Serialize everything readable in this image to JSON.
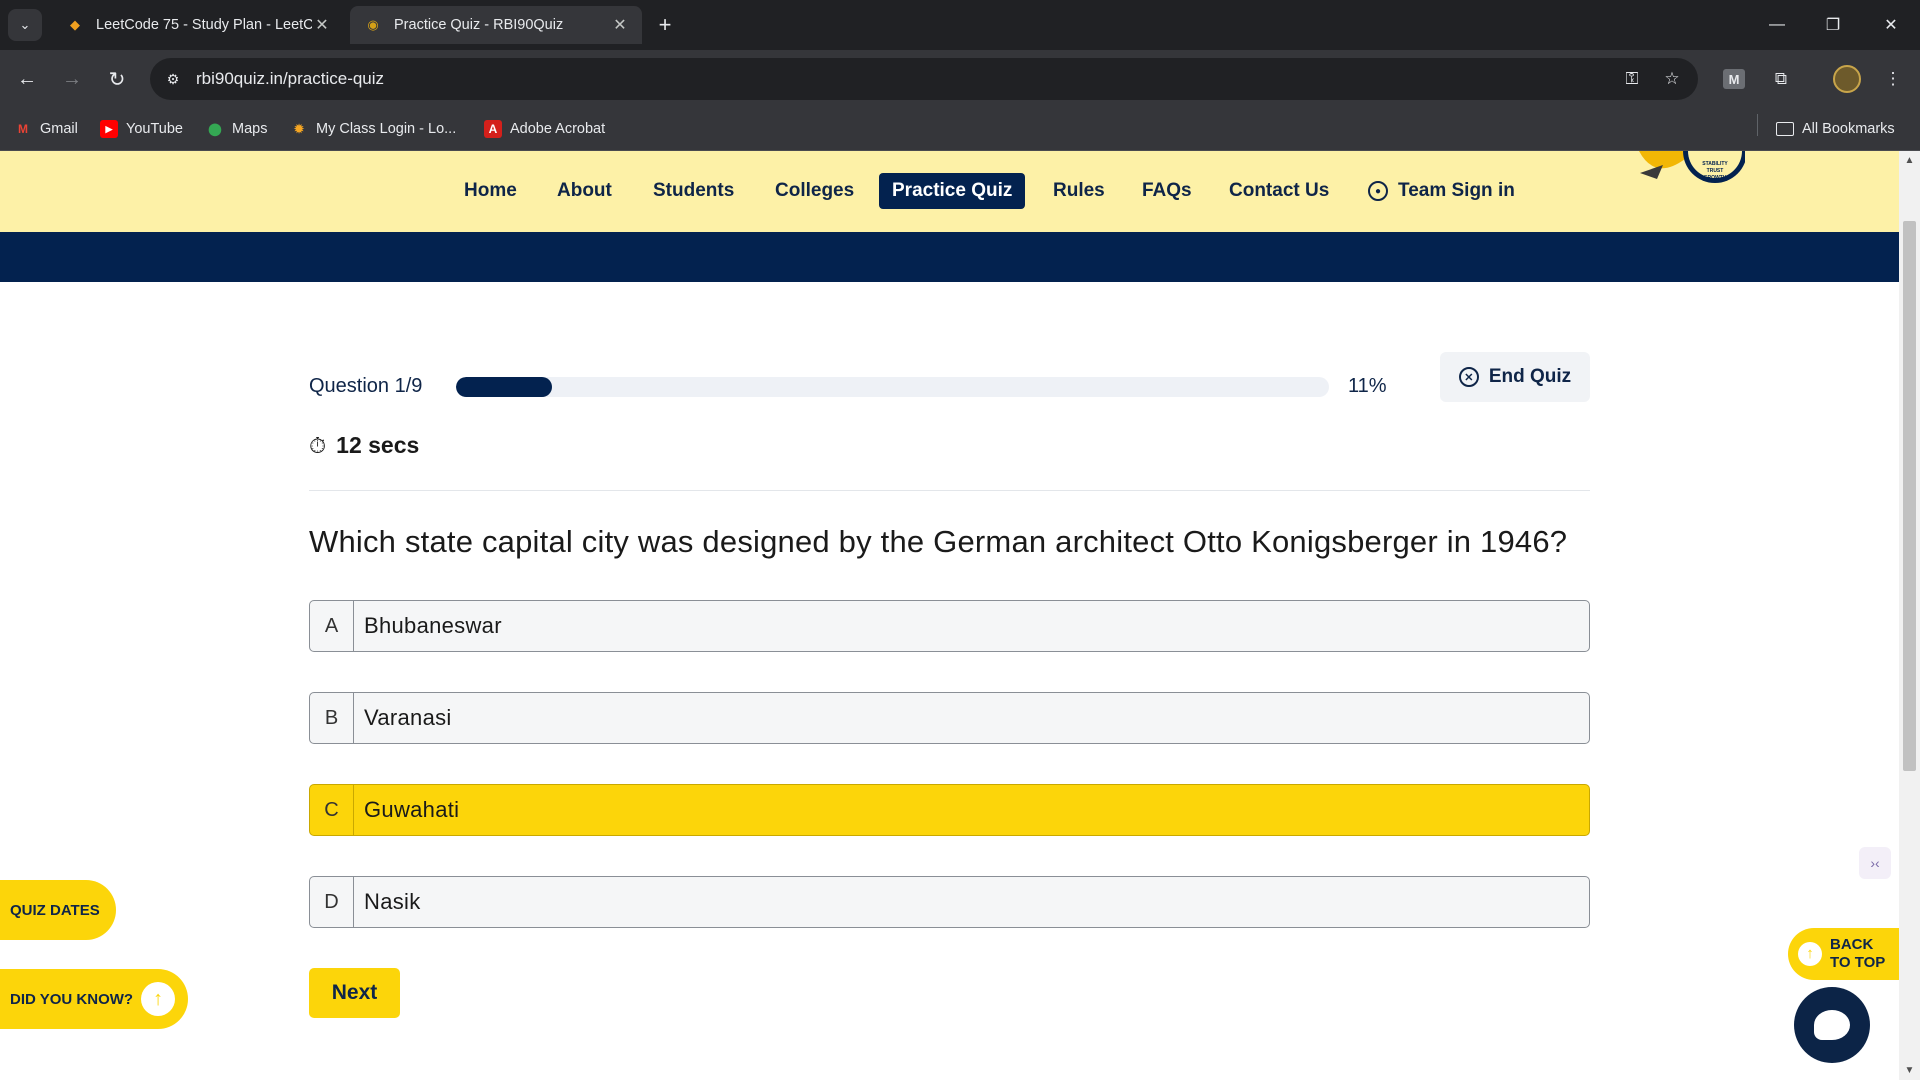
{
  "browser": {
    "tabs": [
      {
        "title": "LeetCode 75 - Study Plan - LeetCode",
        "active": false
      },
      {
        "title": "Practice Quiz - RBI90Quiz",
        "active": true
      }
    ],
    "url": "rbi90quiz.in/practice-quiz",
    "bookmarks": [
      {
        "label": "Gmail",
        "icon": "gmail-icon"
      },
      {
        "label": "YouTube",
        "icon": "youtube-icon"
      },
      {
        "label": "Maps",
        "icon": "maps-icon"
      },
      {
        "label": "My Class Login - Lo...",
        "icon": "sun-icon"
      },
      {
        "label": "Adobe Acrobat",
        "icon": "acrobat-icon"
      }
    ],
    "all_bookmarks": "All Bookmarks",
    "extension_label": "M"
  },
  "site": {
    "nav": [
      {
        "label": "Home",
        "active": false
      },
      {
        "label": "About",
        "active": false
      },
      {
        "label": "Students",
        "active": false
      },
      {
        "label": "Colleges",
        "active": false
      },
      {
        "label": "Practice Quiz",
        "active": true
      },
      {
        "label": "Rules",
        "active": false
      },
      {
        "label": "FAQs",
        "active": false
      },
      {
        "label": "Contact Us",
        "active": false
      }
    ],
    "sign_in": "Team Sign in",
    "logo_words": [
      "STABILITY",
      "TRUST",
      "GROWTH"
    ]
  },
  "quiz": {
    "question_counter": "Question 1/9",
    "progress_fraction": 0.11,
    "progress_label": "11%",
    "end_quiz": "End Quiz",
    "timer": "12 secs",
    "question": "Which state capital city was designed by the German architect Otto Konigsberger in 1946?",
    "options": [
      {
        "letter": "A",
        "text": "Bhubaneswar",
        "selected": false
      },
      {
        "letter": "B",
        "text": "Varanasi",
        "selected": false
      },
      {
        "letter": "C",
        "text": "Guwahati",
        "selected": true
      },
      {
        "letter": "D",
        "text": "Nasik",
        "selected": false
      }
    ],
    "next": "Next"
  },
  "floating": {
    "quiz_dates": "QUIZ DATES",
    "did_you_know": "DID YOU KNOW?",
    "back_to_top_line1": "BACK",
    "back_to_top_line2": "TO TOP"
  },
  "colors": {
    "navy": "#03224f",
    "yellow": "#fcd50a",
    "nav_bg": "#fdf1a7"
  }
}
